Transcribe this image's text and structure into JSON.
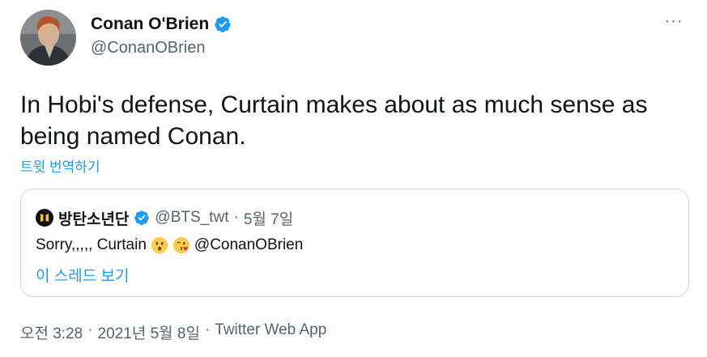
{
  "author": {
    "display_name": "Conan O'Brien",
    "handle": "@ConanOBrien"
  },
  "more_label": "···",
  "tweet_text": "In Hobi's defense, Curtain makes about as much sense as being named Conan.",
  "translate_label": "트윗 번역하기",
  "quoted": {
    "display_name": "방탄소년단",
    "handle": "@BTS_twt",
    "separator": "·",
    "date": "5월 7일",
    "text_prefix": "Sorry,,,,, Curtain",
    "emojis": [
      "hushed-face-emoji",
      "face-blowing-kiss-emoji"
    ],
    "mention": "@ConanOBrien",
    "thread_label": "이 스레드 보기"
  },
  "footer": {
    "time": "오전 3:28",
    "sep1": "·",
    "date": "2021년 5월 8일",
    "sep2": "·",
    "client": "Twitter Web App"
  },
  "colors": {
    "accent": "#1d9bf0",
    "text": "#0f1419",
    "secondary": "#536471",
    "border": "#cfd9de"
  }
}
